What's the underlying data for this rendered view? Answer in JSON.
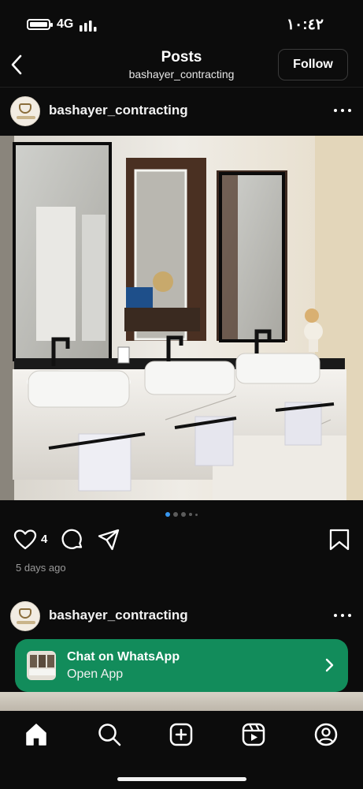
{
  "status_bar": {
    "time": "١٠:٤٢",
    "network": "4G"
  },
  "header": {
    "title": "Posts",
    "subtitle": "bashayer_contracting",
    "follow_label": "Follow"
  },
  "post": {
    "username": "bashayer_contracting",
    "likes": "4",
    "date": "5 days ago",
    "carousel": {
      "count": 5,
      "active": 1
    }
  },
  "next_post": {
    "username": "bashayer_contracting"
  },
  "whatsapp": {
    "title": "Chat on WhatsApp",
    "subtitle": "Open App"
  },
  "icons": {
    "status": [
      "battery-icon",
      "signal-icon"
    ],
    "header": [
      "back-arrow-icon"
    ],
    "post": [
      "more-options-icon",
      "heart-icon",
      "comment-icon",
      "share-icon",
      "bookmark-icon"
    ],
    "tabs": [
      "home-icon",
      "search-icon",
      "create-icon",
      "reels-icon",
      "profile-icon"
    ]
  },
  "colors": {
    "background": "#0c0c0c",
    "accent": "#3897f0",
    "whatsapp_green": "#128c5b"
  }
}
